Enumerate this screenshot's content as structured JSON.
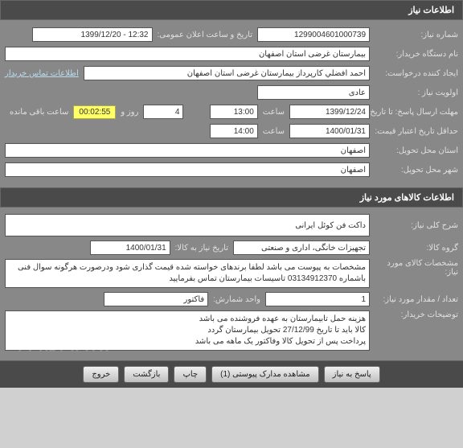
{
  "section1": {
    "title": "اطلاعات نیاز",
    "need_number_label": "شماره نیاز:",
    "need_number": "1299004601000739",
    "public_announce_label": "تاریخ و ساعت اعلان عمومی:",
    "public_announce": "12:32 - 1399/12/20",
    "buyer_org_label": "نام دستگاه خریدار:",
    "buyer_org": "بیمارستان غرضی استان اصفهان",
    "creator_label": "ایجاد کننده درخواست:",
    "creator": "احمد افضلي کارپرداز بیمارستان غرضی استان اصفهان",
    "contact_link": "اطلاعات تماس خریدار",
    "priority_label": "اولویت نیاز :",
    "priority": "عادی",
    "deadline_label": "مهلت ارسال پاسخ:  تا تاریخ :",
    "deadline_date": "1399/12/24",
    "time_label": "ساعت",
    "deadline_time": "13:00",
    "days_remaining": "4",
    "days_label": "روز و",
    "countdown": "00:02:55",
    "remaining_label": "ساعت باقی مانده",
    "validity_label": "حداقل تاریخ اعتبار قیمت:",
    "validity_date": "1400/01/31",
    "validity_time": "14:00",
    "delivery_province_label": "استان محل تحویل:",
    "delivery_province": "اصفهان",
    "delivery_city_label": "شهر محل تحویل:",
    "delivery_city": "اصفهان"
  },
  "section2": {
    "title": "اطلاعات کالاهای مورد نیاز",
    "desc_label": "شرح کلی نیاز:",
    "desc": "داکت فن کوئل ایرانی",
    "group_label": "گروه کالا:",
    "group": "تجهیزات خانگی، اداری و صنعتی",
    "need_date_label": "تاریخ نیاز به کالا:",
    "need_date": "1400/01/31",
    "spec_label": "مشخصات کالای مورد نیاز:",
    "spec": "مشخصات به پیوست می باشد لطفا برندهای خواسته شده قیمت گذاری شود ودرصورت هرگونه سوال فنی باشماره 03134912370 تاسیسات بیمارستان تماس بفرمایید",
    "qty_label": "تعداد / مقدار مورد نیاز:",
    "qty": "1",
    "unit_label": "واحد شمارش:",
    "unit": "فاکتور",
    "buyer_notes_label": "توضیحات خریدار:",
    "buyer_notes": "هزینه حمل تابیمارستان به عهده فروشنده می باشد\nکالا باید تا تاریخ 27/12/99 تحویل بیمارستان گردد\nپرداخت پس از تحویل کالا وفاکتور یک ماهه می باشد",
    "watermark": "۰۲۱-۸۵۱۹۳۷۶۸"
  },
  "footer": {
    "respond": "پاسخ به نیاز",
    "attachments": "مشاهده مدارک پیوستی (1)",
    "print": "چاپ",
    "back": "بازگشت",
    "exit": "خروج"
  }
}
